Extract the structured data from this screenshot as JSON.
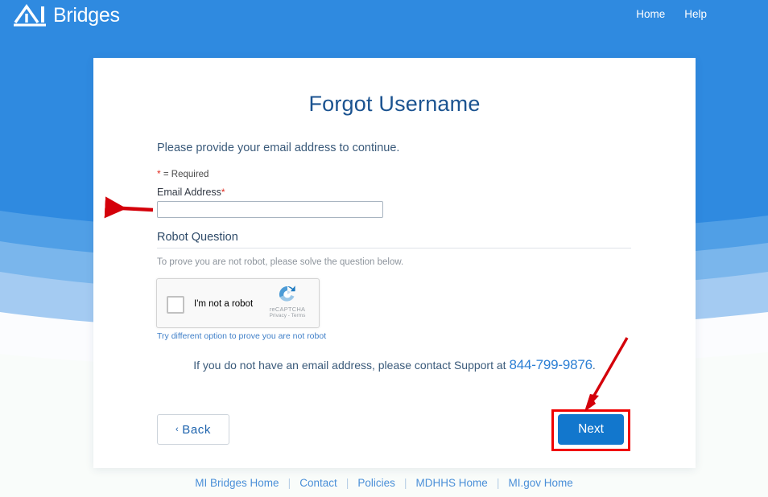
{
  "header": {
    "logo_text": "Bridges",
    "logo_mark": "mi-logo-icon",
    "nav": [
      {
        "label": "Home"
      },
      {
        "label": "Help"
      }
    ]
  },
  "card": {
    "title": "Forgot Username",
    "intro": "Please provide your email address to continue.",
    "required_note": "= Required",
    "required_star": "*",
    "email": {
      "label": "Email Address",
      "value": "",
      "placeholder": ""
    },
    "robot": {
      "heading": "Robot Question",
      "subtitle": "To prove you are not robot, please solve the question below.",
      "captcha_label": "I'm not a robot",
      "captcha_brand": "reCAPTCHA",
      "captcha_legal": "Privacy - Terms",
      "try_different": "Try different option to prove you are not robot"
    },
    "support_prefix": "If you do not have an email address, please contact Support at",
    "support_phone": "844-799-9876",
    "support_suffix": ".",
    "back_label": "Back",
    "back_chevron": "‹",
    "next_label": "Next"
  },
  "footer": {
    "links": [
      {
        "label": "MI Bridges Home"
      },
      {
        "label": "Contact"
      },
      {
        "label": "Policies"
      },
      {
        "label": "MDHHS Home"
      },
      {
        "label": "MI.gov Home"
      }
    ],
    "separator": "|"
  },
  "colors": {
    "header_blue": "#2f8ae0",
    "title_blue": "#1b5390",
    "button_blue": "#1277cd",
    "link_blue": "#4a8fd8",
    "annotation_red": "#f00000",
    "required_red": "#e02b20"
  }
}
